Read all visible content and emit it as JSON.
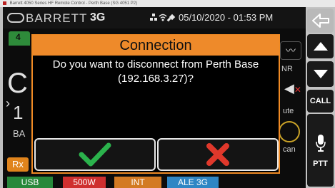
{
  "window": {
    "title": "Barrett 4050 Series HF Remote Control - Perth Base (SG 4051 P2)"
  },
  "statusbar": {
    "logo": "BARRETT",
    "mode": "3G",
    "datetime": "05/10/2020 - 01:53 PM",
    "icons": [
      "network-icon",
      "wifi-icon",
      "satellite-icon"
    ]
  },
  "background": {
    "green_tab": "4",
    "big_letter": "C",
    "arrow": "›",
    "channel_digit": "1",
    "ba_text": "BA",
    "rx": "Rx",
    "nr": "NR",
    "mute": "ute",
    "scan": "can"
  },
  "dialog": {
    "title": "Connection",
    "message_line1": "Do you want to disconnect from Perth Base",
    "message_line2": "(192.168.3.27)?",
    "confirm_icon": "checkmark-icon",
    "cancel_icon": "x-icon"
  },
  "bottombar": {
    "tabs": [
      {
        "label": "USB",
        "color": "#27883a"
      },
      {
        "label": "500W",
        "color": "#cf2f2f"
      },
      {
        "label": "INT",
        "color": "#d37a23"
      },
      {
        "label": "ALE 3G",
        "color": "#2f86c4"
      }
    ]
  },
  "sidepanel": {
    "call_label": "CALL",
    "ptt_label": "PTT"
  },
  "colors": {
    "accent": "#ee8a2a",
    "confirm": "#2bb24c",
    "cancel": "#e0382b"
  }
}
